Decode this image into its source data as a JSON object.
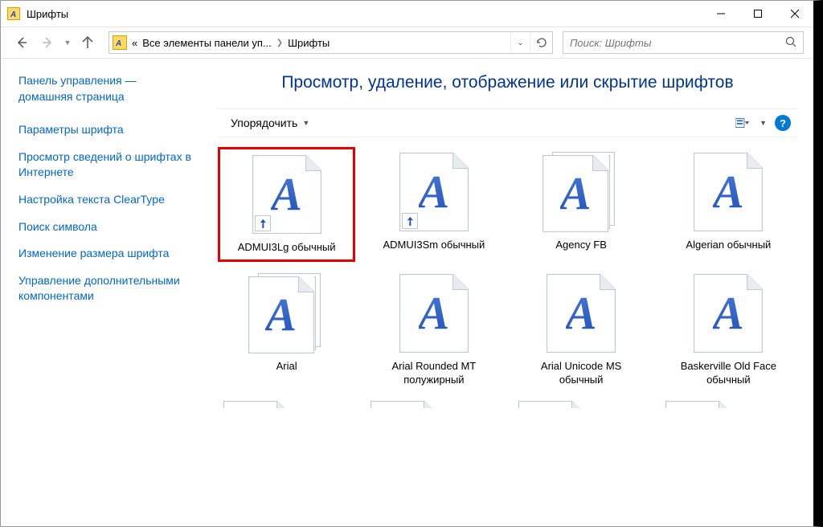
{
  "window": {
    "title": "Шрифты"
  },
  "nav": {
    "breadcrumb_prefix": "«",
    "crumb1": "Все элементы панели уп...",
    "crumb2": "Шрифты",
    "search_placeholder": "Поиск: Шрифты"
  },
  "sidebar": {
    "home": "Панель управления — домашняя страница",
    "links": [
      "Параметры шрифта",
      "Просмотр сведений о шрифтах в Интернете",
      "Настройка текста ClearType",
      "Поиск символа",
      "Изменение размера шрифта",
      "Управление дополнительными компонентами"
    ]
  },
  "main": {
    "title": "Просмотр, удаление, отображение или скрытие шрифтов",
    "toolbar": {
      "organize": "Упорядочить"
    },
    "fonts": [
      {
        "name": "ADMUI3Lg обычный",
        "selected": true,
        "shortcut": true,
        "family": false
      },
      {
        "name": "ADMUI3Sm обычный",
        "selected": false,
        "shortcut": true,
        "family": false
      },
      {
        "name": "Agency FB",
        "selected": false,
        "shortcut": false,
        "family": true
      },
      {
        "name": "Algerian обычный",
        "selected": false,
        "shortcut": false,
        "family": false
      },
      {
        "name": "Arial",
        "selected": false,
        "shortcut": false,
        "family": true
      },
      {
        "name": "Arial Rounded MT полужирный",
        "selected": false,
        "shortcut": false,
        "family": false
      },
      {
        "name": "Arial Unicode MS обычный",
        "selected": false,
        "shortcut": false,
        "family": false
      },
      {
        "name": "Baskerville Old Face обычный",
        "selected": false,
        "shortcut": false,
        "family": false
      }
    ]
  }
}
